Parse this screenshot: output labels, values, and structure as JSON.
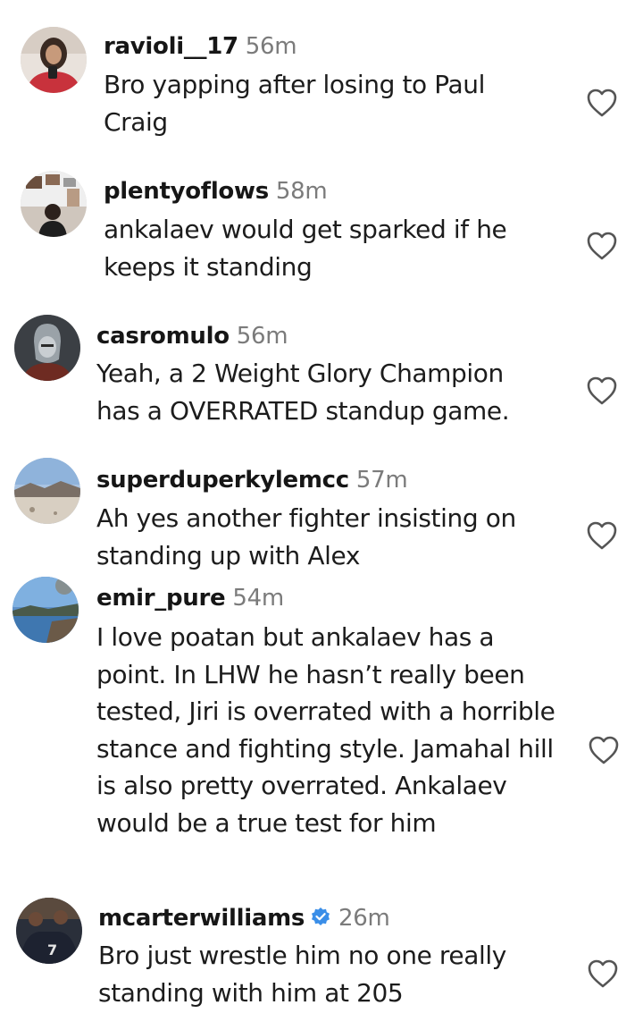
{
  "comments": [
    {
      "username": "ravioli__17",
      "time": "56m",
      "text": "Bro yapping after losing to Paul Craig",
      "verified": false
    },
    {
      "username": "plentyoflows",
      "time": "58m",
      "text": "ankalaev would get sparked if he keeps it standing",
      "verified": false
    },
    {
      "username": "casromulo",
      "time": "56m",
      "text": "Yeah, a 2 Weight Glory Champion has a OVERRATED standup game.",
      "verified": false
    },
    {
      "username": "superduperkylemcc",
      "time": "57m",
      "text": "Ah yes another fighter insisting on standing up with Alex",
      "verified": false
    },
    {
      "username": "emir_pure",
      "time": "54m",
      "text": "I love poatan but ankalaev has a point. In LHW he hasn’t really been tested, Jiri is overrated with a horrible stance and fighting style. Jamahal hill is also pretty overrated. Ankalaev would be a true test for him",
      "verified": false
    },
    {
      "username": "mcarterwilliams",
      "time": "26m",
      "text": "Bro just wrestle him no one really standing with him at 205",
      "verified": true
    }
  ],
  "icons": {
    "like": "heart-outline-icon",
    "verified": "verified-badge-icon"
  },
  "colors": {
    "username": "#161616",
    "timestamp": "#7b7b7b",
    "verified_badge": "#3a8ee8",
    "heart_outline": "#555555"
  }
}
